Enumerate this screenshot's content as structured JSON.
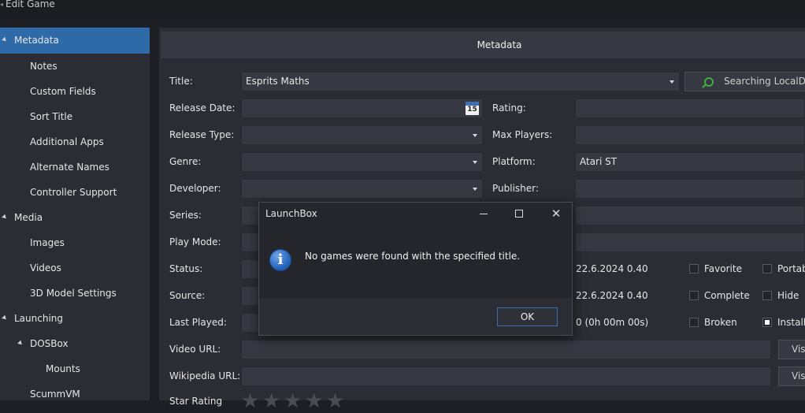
{
  "window": {
    "title": "Edit Game"
  },
  "sidebar": {
    "items": [
      {
        "label": "Metadata"
      },
      {
        "label": "Notes"
      },
      {
        "label": "Custom Fields"
      },
      {
        "label": "Sort Title"
      },
      {
        "label": "Additional Apps"
      },
      {
        "label": "Alternate Names"
      },
      {
        "label": "Controller Support"
      },
      {
        "label": "Media"
      },
      {
        "label": "Images"
      },
      {
        "label": "Videos"
      },
      {
        "label": "3D Model Settings"
      },
      {
        "label": "Launching"
      },
      {
        "label": "DOSBox"
      },
      {
        "label": "Mounts"
      },
      {
        "label": "ScummVM"
      }
    ]
  },
  "main": {
    "header": "Metadata",
    "labels": {
      "title": "Title:",
      "release_date": "Release Date:",
      "release_type": "Release Type:",
      "genre": "Genre:",
      "developer": "Developer:",
      "series": "Series:",
      "play_mode": "Play Mode:",
      "status": "Status:",
      "source": "Source:",
      "last_played": "Last Played:",
      "video_url": "Video URL:",
      "wikipedia_url": "Wikipedia URL:",
      "star_rating": "Star Rating",
      "rating": "Rating:",
      "max_players": "Max Players:",
      "platform": "Platform:",
      "publisher": "Publisher:"
    },
    "values": {
      "title": "Esprits Maths",
      "platform": "Atari ST",
      "date_added": "22.6.2024 0.40",
      "date_modified": "22.6.2024 0.40",
      "play_time": "0 (0h 00m 00s)",
      "calendar_day": "15"
    },
    "search_button": "Searching LocalDB...",
    "visit_button": "Visit",
    "checkboxes": [
      {
        "label": "Favorite",
        "checked": false
      },
      {
        "label": "Portable",
        "checked": false
      },
      {
        "label": "Complete",
        "checked": false
      },
      {
        "label": "Hide",
        "checked": false
      },
      {
        "label": "Broken",
        "checked": false
      },
      {
        "label": "Installed",
        "checked": true
      }
    ]
  },
  "dialog": {
    "title": "LaunchBox",
    "message": "No games were found with the specified title.",
    "ok": "OK",
    "close": "✕"
  },
  "colors": {
    "accent": "#2f6aa8",
    "background": "#1e1f24",
    "panel": "#2b2d34"
  }
}
